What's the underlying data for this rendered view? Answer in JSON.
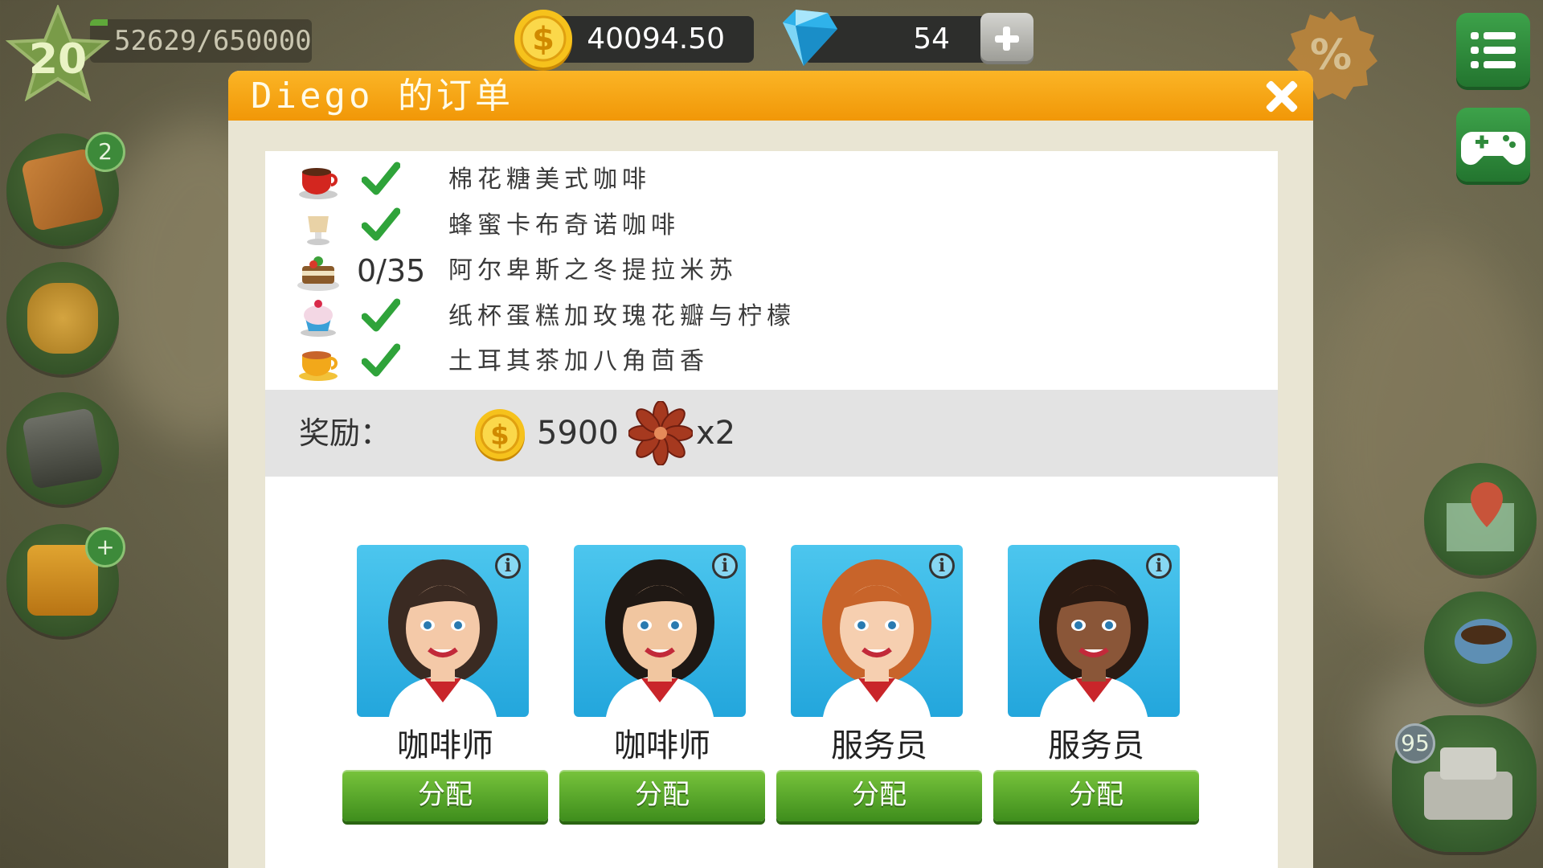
{
  "hud": {
    "level": "20",
    "xp_text": "52629/650000",
    "xp_progress": 0.081,
    "coins": "40094.50",
    "gems": "54"
  },
  "side": {
    "recipe_book_badge": "2",
    "register_badge": "95"
  },
  "dialog": {
    "title": "Diego 的订单",
    "items": [
      {
        "icon": "red-coffee-cup-icon",
        "status": "done",
        "progress": "",
        "name": "棉花糖美式咖啡"
      },
      {
        "icon": "latte-glass-icon",
        "status": "done",
        "progress": "",
        "name": "蜂蜜卡布奇诺咖啡"
      },
      {
        "icon": "tiramisu-cake-icon",
        "status": "pending",
        "progress": "0/35",
        "name": "阿尔卑斯之冬提拉米苏"
      },
      {
        "icon": "cupcake-icon",
        "status": "done",
        "progress": "",
        "name": "纸杯蛋糕加玫瑰花瓣与柠檬"
      },
      {
        "icon": "tea-cup-icon",
        "status": "done",
        "progress": "",
        "name": "土耳其茶加八角茴香"
      }
    ],
    "reward_label": "奖励：",
    "reward_coins": "5900",
    "reward_item_mult": "x2",
    "staff": [
      {
        "role": "咖啡师",
        "assign": "分配",
        "hair": "#3a2a22",
        "skin": "#f4c9a8"
      },
      {
        "role": "咖啡师",
        "assign": "分配",
        "hair": "#1f1814",
        "skin": "#f1c6a0"
      },
      {
        "role": "服务员",
        "assign": "分配",
        "hair": "#c8642a",
        "skin": "#f6cfb0"
      },
      {
        "role": "服务员",
        "assign": "分配",
        "hair": "#2a1a12",
        "skin": "#8a5638"
      }
    ],
    "info_glyph": "i"
  },
  "colors": {
    "header_orange": "#f5a315",
    "assign_green": "#5aa82a",
    "check_green": "#2fa33a"
  }
}
